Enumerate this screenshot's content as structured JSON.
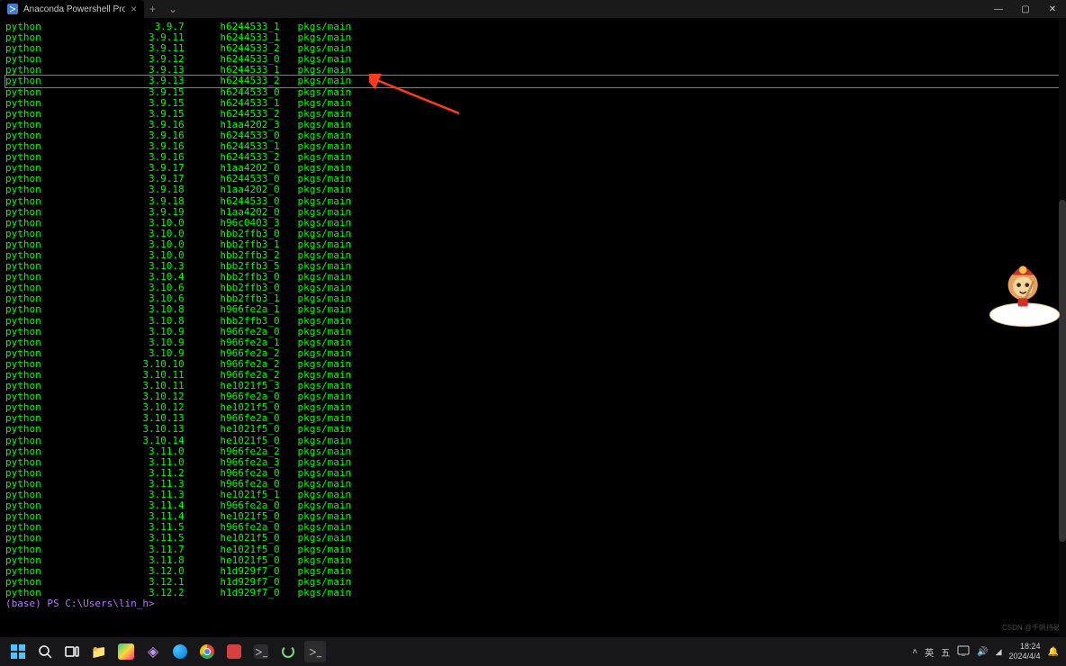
{
  "titlebar": {
    "tab_title": "Anaconda Powershell Prompt",
    "tab_close": "×",
    "new_tab": "+",
    "dropdown": "⌄"
  },
  "win": {
    "min": "—",
    "max": "▢",
    "close": "✕"
  },
  "terminal": {
    "rows": [
      {
        "name": "python",
        "ver": "3.9.7",
        "build": "h6244533_1",
        "chan": "pkgs/main",
        "hl": false
      },
      {
        "name": "python",
        "ver": "3.9.11",
        "build": "h6244533_1",
        "chan": "pkgs/main",
        "hl": false
      },
      {
        "name": "python",
        "ver": "3.9.11",
        "build": "h6244533_2",
        "chan": "pkgs/main",
        "hl": false
      },
      {
        "name": "python",
        "ver": "3.9.12",
        "build": "h6244533_0",
        "chan": "pkgs/main",
        "hl": false
      },
      {
        "name": "python",
        "ver": "3.9.13",
        "build": "h6244533_1",
        "chan": "pkgs/main",
        "hl": false
      },
      {
        "name": "python",
        "ver": "3.9.13",
        "build": "h6244533_2",
        "chan": "pkgs/main",
        "hl": true
      },
      {
        "name": "python",
        "ver": "3.9.15",
        "build": "h6244533_0",
        "chan": "pkgs/main",
        "hl": false
      },
      {
        "name": "python",
        "ver": "3.9.15",
        "build": "h6244533_1",
        "chan": "pkgs/main",
        "hl": false
      },
      {
        "name": "python",
        "ver": "3.9.15",
        "build": "h6244533_2",
        "chan": "pkgs/main",
        "hl": false
      },
      {
        "name": "python",
        "ver": "3.9.16",
        "build": "h1aa4202_3",
        "chan": "pkgs/main",
        "hl": false
      },
      {
        "name": "python",
        "ver": "3.9.16",
        "build": "h6244533_0",
        "chan": "pkgs/main",
        "hl": false
      },
      {
        "name": "python",
        "ver": "3.9.16",
        "build": "h6244533_1",
        "chan": "pkgs/main",
        "hl": false
      },
      {
        "name": "python",
        "ver": "3.9.16",
        "build": "h6244533_2",
        "chan": "pkgs/main",
        "hl": false
      },
      {
        "name": "python",
        "ver": "3.9.17",
        "build": "h1aa4202_0",
        "chan": "pkgs/main",
        "hl": false
      },
      {
        "name": "python",
        "ver": "3.9.17",
        "build": "h6244533_0",
        "chan": "pkgs/main",
        "hl": false
      },
      {
        "name": "python",
        "ver": "3.9.18",
        "build": "h1aa4202_0",
        "chan": "pkgs/main",
        "hl": false
      },
      {
        "name": "python",
        "ver": "3.9.18",
        "build": "h6244533_0",
        "chan": "pkgs/main",
        "hl": false
      },
      {
        "name": "python",
        "ver": "3.9.19",
        "build": "h1aa4202_0",
        "chan": "pkgs/main",
        "hl": false
      },
      {
        "name": "python",
        "ver": "3.10.0",
        "build": "h96c0403_3",
        "chan": "pkgs/main",
        "hl": false
      },
      {
        "name": "python",
        "ver": "3.10.0",
        "build": "hbb2ffb3_0",
        "chan": "pkgs/main",
        "hl": false
      },
      {
        "name": "python",
        "ver": "3.10.0",
        "build": "hbb2ffb3_1",
        "chan": "pkgs/main",
        "hl": false
      },
      {
        "name": "python",
        "ver": "3.10.0",
        "build": "hbb2ffb3_2",
        "chan": "pkgs/main",
        "hl": false
      },
      {
        "name": "python",
        "ver": "3.10.3",
        "build": "hbb2ffb3_5",
        "chan": "pkgs/main",
        "hl": false
      },
      {
        "name": "python",
        "ver": "3.10.4",
        "build": "hbb2ffb3_0",
        "chan": "pkgs/main",
        "hl": false
      },
      {
        "name": "python",
        "ver": "3.10.6",
        "build": "hbb2ffb3_0",
        "chan": "pkgs/main",
        "hl": false
      },
      {
        "name": "python",
        "ver": "3.10.6",
        "build": "hbb2ffb3_1",
        "chan": "pkgs/main",
        "hl": false
      },
      {
        "name": "python",
        "ver": "3.10.8",
        "build": "h966fe2a_1",
        "chan": "pkgs/main",
        "hl": false
      },
      {
        "name": "python",
        "ver": "3.10.8",
        "build": "hbb2ffb3_0",
        "chan": "pkgs/main",
        "hl": false
      },
      {
        "name": "python",
        "ver": "3.10.9",
        "build": "h966fe2a_0",
        "chan": "pkgs/main",
        "hl": false
      },
      {
        "name": "python",
        "ver": "3.10.9",
        "build": "h966fe2a_1",
        "chan": "pkgs/main",
        "hl": false
      },
      {
        "name": "python",
        "ver": "3.10.9",
        "build": "h966fe2a_2",
        "chan": "pkgs/main",
        "hl": false
      },
      {
        "name": "python",
        "ver": "3.10.10",
        "build": "h966fe2a_2",
        "chan": "pkgs/main",
        "hl": false
      },
      {
        "name": "python",
        "ver": "3.10.11",
        "build": "h966fe2a_2",
        "chan": "pkgs/main",
        "hl": false
      },
      {
        "name": "python",
        "ver": "3.10.11",
        "build": "he1021f5_3",
        "chan": "pkgs/main",
        "hl": false
      },
      {
        "name": "python",
        "ver": "3.10.12",
        "build": "h966fe2a_0",
        "chan": "pkgs/main",
        "hl": false
      },
      {
        "name": "python",
        "ver": "3.10.12",
        "build": "he1021f5_0",
        "chan": "pkgs/main",
        "hl": false
      },
      {
        "name": "python",
        "ver": "3.10.13",
        "build": "h966fe2a_0",
        "chan": "pkgs/main",
        "hl": false
      },
      {
        "name": "python",
        "ver": "3.10.13",
        "build": "he1021f5_0",
        "chan": "pkgs/main",
        "hl": false
      },
      {
        "name": "python",
        "ver": "3.10.14",
        "build": "he1021f5_0",
        "chan": "pkgs/main",
        "hl": false
      },
      {
        "name": "python",
        "ver": "3.11.0",
        "build": "h966fe2a_2",
        "chan": "pkgs/main",
        "hl": false
      },
      {
        "name": "python",
        "ver": "3.11.0",
        "build": "h966fe2a_3",
        "chan": "pkgs/main",
        "hl": false
      },
      {
        "name": "python",
        "ver": "3.11.2",
        "build": "h966fe2a_0",
        "chan": "pkgs/main",
        "hl": false
      },
      {
        "name": "python",
        "ver": "3.11.3",
        "build": "h966fe2a_0",
        "chan": "pkgs/main",
        "hl": false
      },
      {
        "name": "python",
        "ver": "3.11.3",
        "build": "he1021f5_1",
        "chan": "pkgs/main",
        "hl": false
      },
      {
        "name": "python",
        "ver": "3.11.4",
        "build": "h966fe2a_0",
        "chan": "pkgs/main",
        "hl": false
      },
      {
        "name": "python",
        "ver": "3.11.4",
        "build": "he1021f5_0",
        "chan": "pkgs/main",
        "hl": false
      },
      {
        "name": "python",
        "ver": "3.11.5",
        "build": "h966fe2a_0",
        "chan": "pkgs/main",
        "hl": false
      },
      {
        "name": "python",
        "ver": "3.11.5",
        "build": "he1021f5_0",
        "chan": "pkgs/main",
        "hl": false
      },
      {
        "name": "python",
        "ver": "3.11.7",
        "build": "he1021f5_0",
        "chan": "pkgs/main",
        "hl": false
      },
      {
        "name": "python",
        "ver": "3.11.8",
        "build": "he1021f5_0",
        "chan": "pkgs/main",
        "hl": false
      },
      {
        "name": "python",
        "ver": "3.12.0",
        "build": "h1d929f7_0",
        "chan": "pkgs/main",
        "hl": false
      },
      {
        "name": "python",
        "ver": "3.12.1",
        "build": "h1d929f7_0",
        "chan": "pkgs/main",
        "hl": false
      },
      {
        "name": "python",
        "ver": "3.12.2",
        "build": "h1d929f7_0",
        "chan": "pkgs/main",
        "hl": false
      }
    ],
    "prompt": "(base) PS C:\\Users\\lin_h>"
  },
  "watermark": "CSDN @千帆待破",
  "taskbar": {
    "ime": "英",
    "ime2": "五",
    "time": "18:24",
    "date": "2024/4/4"
  }
}
